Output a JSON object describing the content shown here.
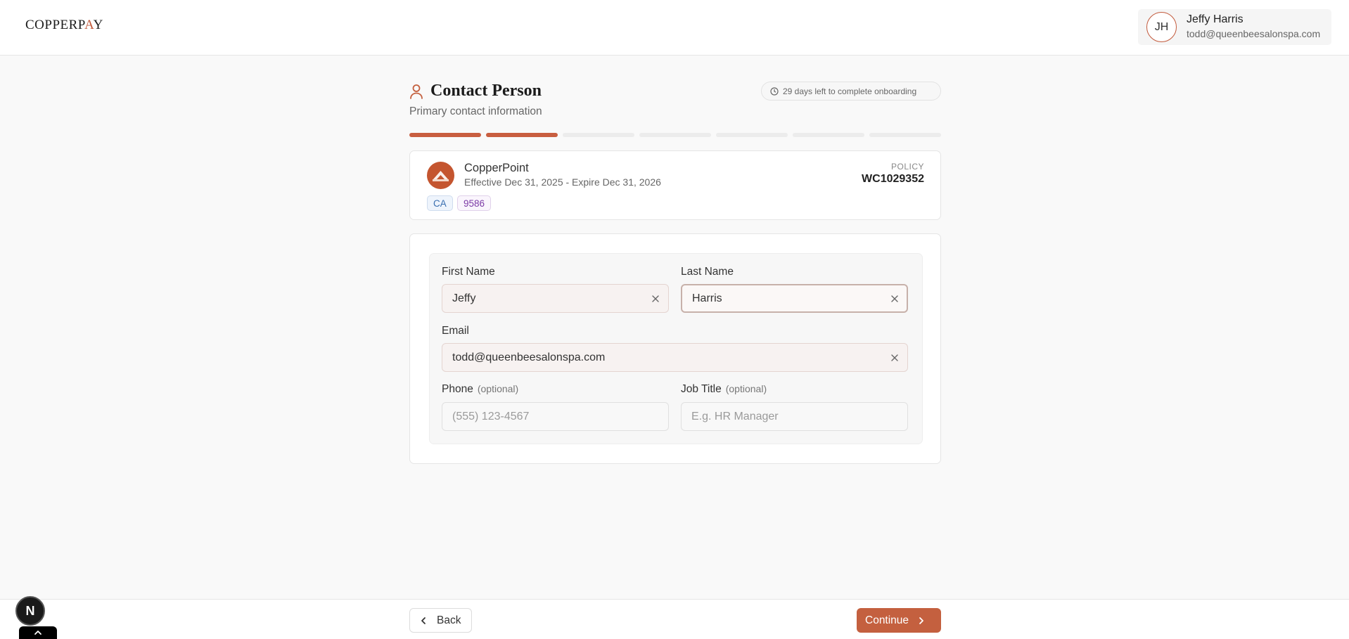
{
  "app": {
    "logo_main": "COPPERP",
    "logo_accent": "A",
    "logo_tail": "Y"
  },
  "user": {
    "initials": "JH",
    "name": "Jeffy Harris",
    "email": "todd@queenbeesalonspa.com"
  },
  "header": {
    "title": "Contact Person",
    "subtitle": "Primary contact information",
    "days_left": "29 days left to complete onboarding",
    "icon": "person-icon"
  },
  "progress": {
    "total_steps": 7,
    "completed_steps": 2
  },
  "policy": {
    "carrier": "CopperPoint",
    "dates": "Effective Dec 31, 2025 - Expire Dec 31, 2026",
    "state": "CA",
    "code": "9586",
    "label": "POLICY",
    "number": "WC1029352"
  },
  "form": {
    "first_name": {
      "label": "First Name",
      "value": "Jeffy"
    },
    "last_name": {
      "label": "Last Name",
      "value": "Harris"
    },
    "email": {
      "label": "Email",
      "value": "todd@queenbeesalonspa.com"
    },
    "phone": {
      "label": "Phone",
      "optional": "(optional)",
      "value": "",
      "placeholder": "(555) 123-4567"
    },
    "job_title": {
      "label": "Job Title",
      "optional": "(optional)",
      "value": "",
      "placeholder": "E.g. HR Manager"
    }
  },
  "footer": {
    "back_label": "Back",
    "continue_label": "Continue"
  },
  "dev": {
    "badge": "N"
  },
  "colors": {
    "accent": "#c4603f",
    "background": "#f9f9f9",
    "progress_done": "#c85e40",
    "progress_todo": "#ececec"
  }
}
